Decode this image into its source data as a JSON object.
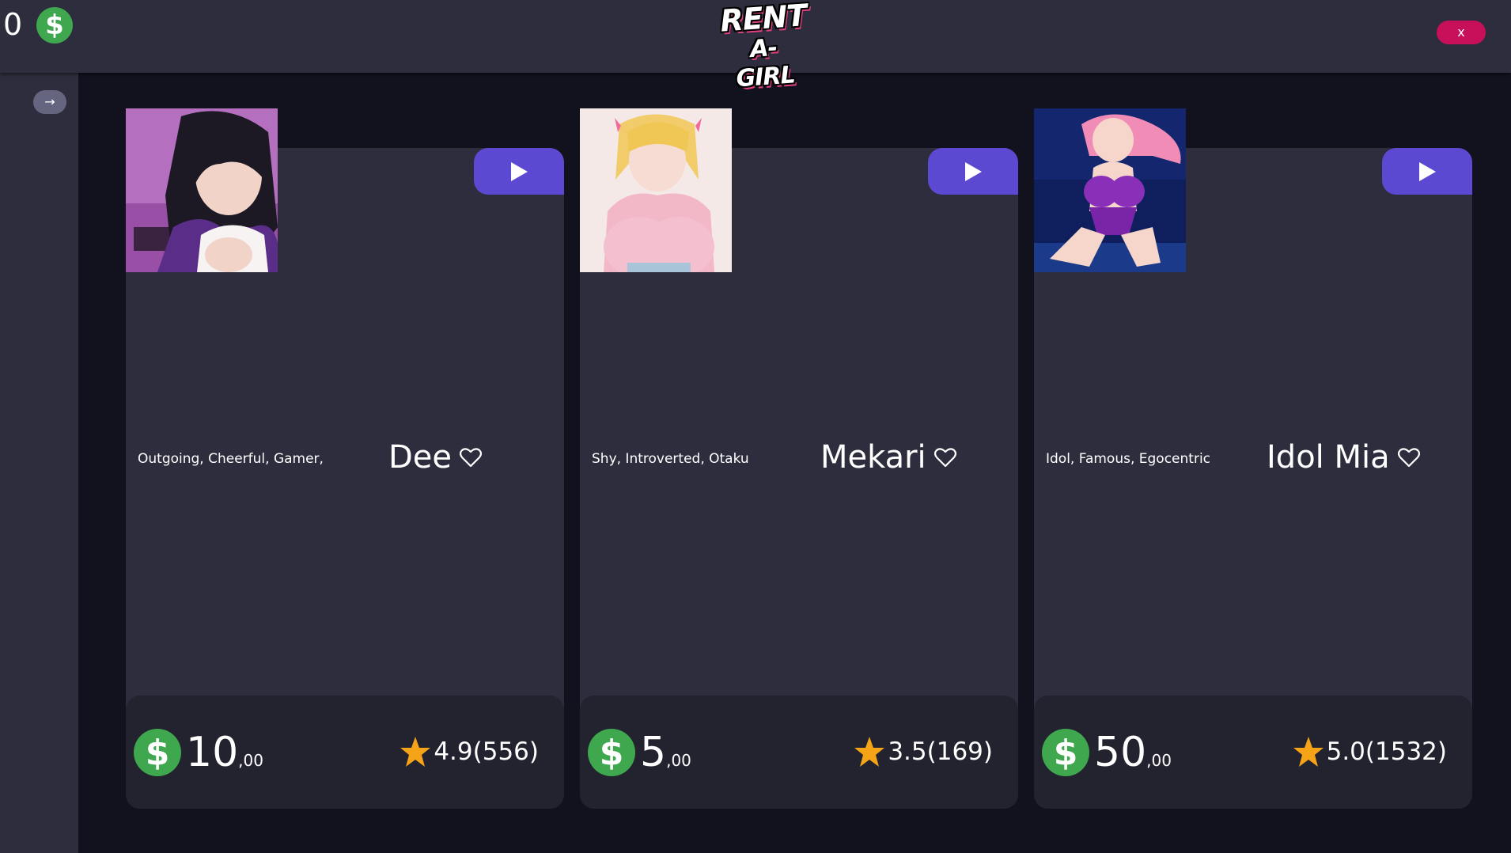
{
  "header": {
    "balance": "0",
    "logo_line1": "RENT",
    "logo_line2": "A-GIRL",
    "close_label": "x",
    "currency_icon": "dollar-coin-icon",
    "colors": {
      "bar": "#2e2d3d",
      "close": "#c8105a",
      "coin": "#3fa84f",
      "accent": "#5b4ad1"
    }
  },
  "sidebar": {
    "expand_label": "→"
  },
  "cards": [
    {
      "traits": "Outgoing, Cheerful, Gamer,",
      "name": "Dee",
      "price_main": "10",
      "price_cents": ",00",
      "rating": "4.9(556)"
    },
    {
      "traits": "Shy, Introverted, Otaku",
      "name": "Mekari",
      "price_main": "5",
      "price_cents": ",00",
      "rating": "3.5(169)"
    },
    {
      "traits": "Idol, Famous, Egocentric",
      "name": "Idol Mia",
      "price_main": "50",
      "price_cents": ",00",
      "rating": "5.0(1532)"
    }
  ],
  "icons": {
    "play": "play-icon",
    "favorite": "heart-outline-icon",
    "rating": "star-icon",
    "currency": "dollar-coin-icon"
  }
}
